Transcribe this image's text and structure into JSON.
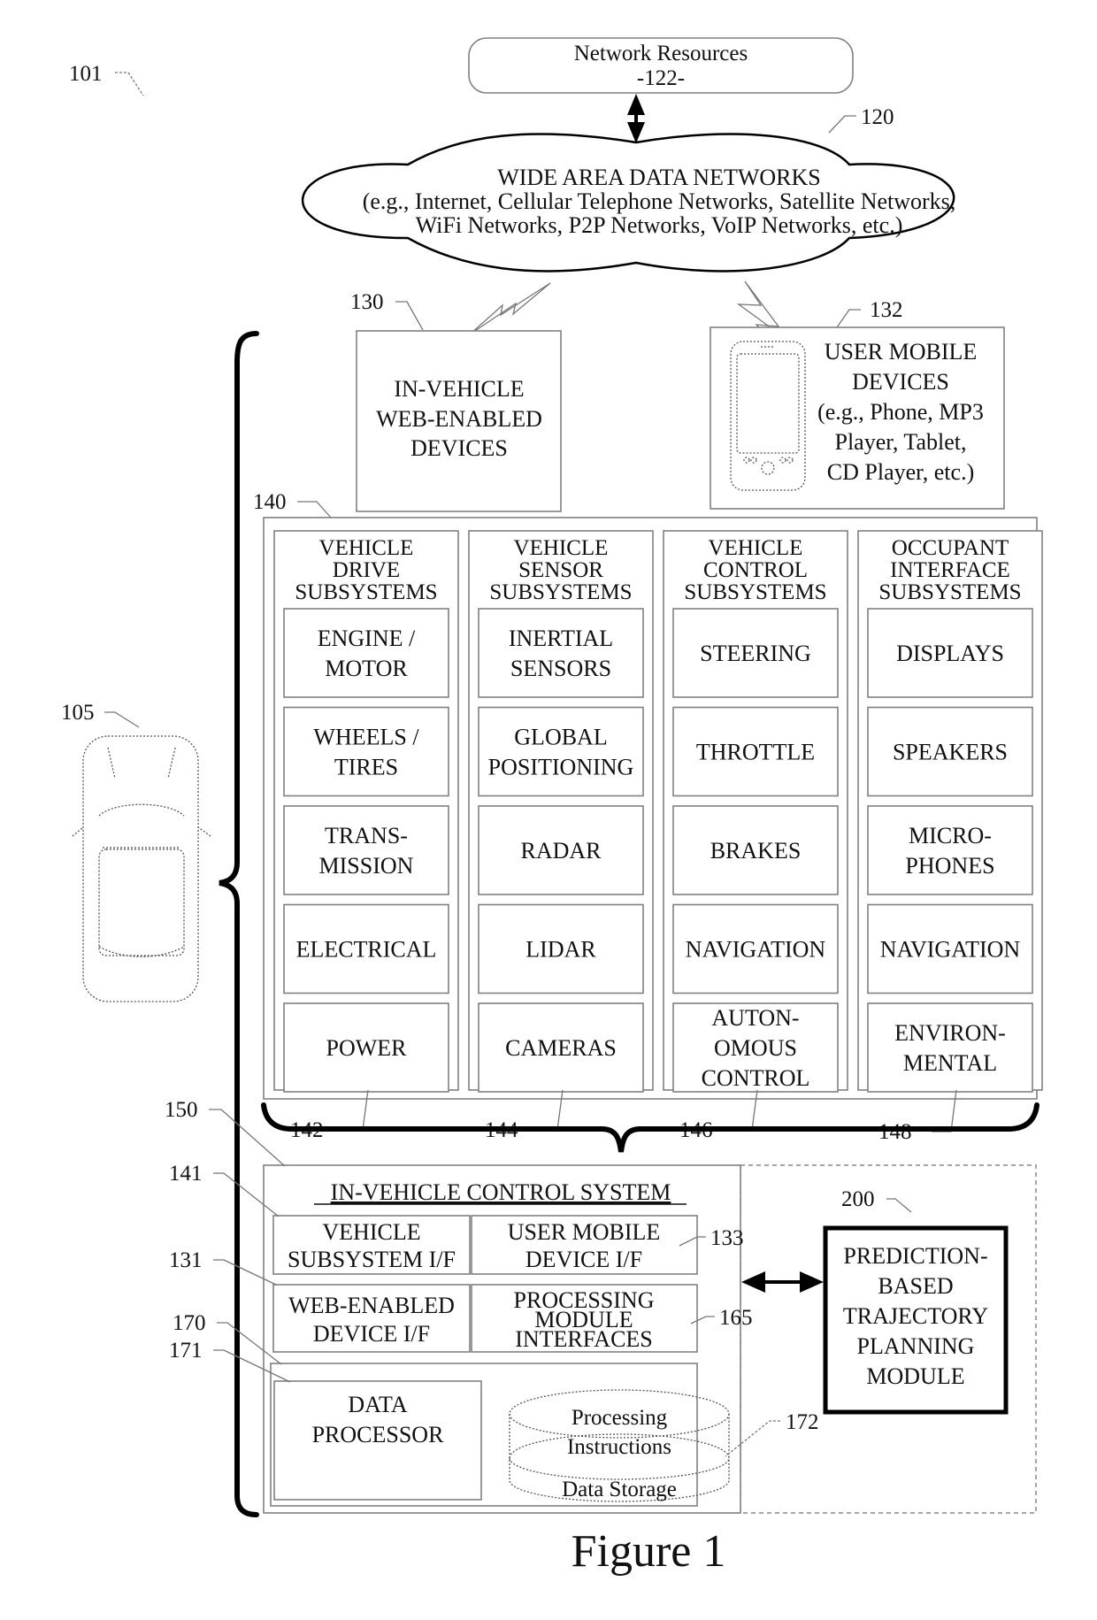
{
  "figure": {
    "caption": "Figure 1",
    "system_ref": "101"
  },
  "network_resources": {
    "label": "Network Resources",
    "ref": "-122-"
  },
  "wan": {
    "ref": "120",
    "title": "WIDE AREA DATA NETWORKS",
    "line2": "(e.g., Internet, Cellular Telephone Networks, Satellite Networks,",
    "line3": "WiFi Networks, P2P Networks, VoIP Networks, etc.)"
  },
  "in_vehicle_devices": {
    "ref": "130",
    "lines": [
      "IN-VEHICLE",
      "WEB-ENABLED",
      "DEVICES"
    ]
  },
  "user_mobile_devices": {
    "ref": "132",
    "lines": [
      "USER MOBILE",
      "DEVICES",
      "(e.g., Phone, MP3",
      "Player, Tablet,",
      "CD Player, etc.)"
    ]
  },
  "vehicle": {
    "ref": "105"
  },
  "subsystems": {
    "ref": "140",
    "groups": [
      {
        "ref": "142",
        "title": [
          "VEHICLE",
          "DRIVE",
          "SUBSYSTEMS"
        ],
        "items": [
          [
            "ENGINE /",
            "MOTOR"
          ],
          [
            "WHEELS /",
            "TIRES"
          ],
          [
            "TRANS-",
            "MISSION"
          ],
          [
            "ELECTRICAL"
          ],
          [
            "POWER"
          ]
        ]
      },
      {
        "ref": "144",
        "title": [
          "VEHICLE",
          "SENSOR",
          "SUBSYSTEMS"
        ],
        "items": [
          [
            "INERTIAL",
            "SENSORS"
          ],
          [
            "GLOBAL",
            "POSITIONING"
          ],
          [
            "RADAR"
          ],
          [
            "LIDAR"
          ],
          [
            "CAMERAS"
          ]
        ]
      },
      {
        "ref": "146",
        "title": [
          "VEHICLE",
          "CONTROL",
          "SUBSYSTEMS"
        ],
        "items": [
          [
            "STEERING"
          ],
          [
            "THROTTLE"
          ],
          [
            "BRAKES"
          ],
          [
            "NAVIGATION"
          ],
          [
            "AUTON-",
            "OMOUS",
            "CONTROL"
          ]
        ]
      },
      {
        "ref": "148",
        "title": [
          "OCCUPANT",
          "INTERFACE",
          "SUBSYSTEMS"
        ],
        "items": [
          [
            "DISPLAYS"
          ],
          [
            "SPEAKERS"
          ],
          [
            "MICRO-",
            "PHONES"
          ],
          [
            "NAVIGATION"
          ],
          [
            "ENVIRON-",
            "MENTAL"
          ]
        ]
      }
    ]
  },
  "control_system": {
    "ref": "150",
    "title": "IN-VEHICLE CONTROL SYSTEM",
    "vehicle_subsystem_if": {
      "ref": "141",
      "lines": [
        "VEHICLE",
        "SUBSYSTEM I/F"
      ]
    },
    "user_mobile_device_if": {
      "ref": "133",
      "lines": [
        "USER MOBILE",
        "DEVICE I/F"
      ]
    },
    "web_enabled_device_if": {
      "ref": "131",
      "lines": [
        "WEB-ENABLED",
        "DEVICE I/F"
      ]
    },
    "processing_module_if": {
      "ref": "165",
      "lines": [
        "PROCESSING",
        "MODULE",
        "INTERFACES"
      ]
    },
    "computing": {
      "ref": "170"
    },
    "data_processor": {
      "ref": "171",
      "lines": [
        "DATA",
        "PROCESSOR"
      ]
    },
    "data_storage": {
      "ref": "172",
      "lines": [
        "Processing",
        "Instructions",
        "Data Storage"
      ]
    }
  },
  "prediction_module": {
    "ref": "200",
    "lines": [
      "PREDICTION-",
      "BASED",
      "TRAJECTORY",
      "PLANNING",
      "MODULE"
    ]
  }
}
